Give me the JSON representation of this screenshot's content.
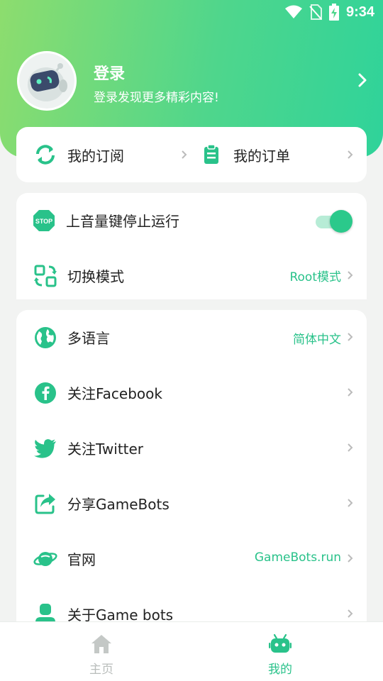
{
  "status": {
    "time": "9:34"
  },
  "profile": {
    "title": "登录",
    "subtitle": "登录发现更多精彩内容!"
  },
  "quick": {
    "subscriptions": "我的订阅",
    "orders": "我的订单"
  },
  "settings": {
    "volume_stop": {
      "label": "上音量键停止运行",
      "stop_text": "STOP",
      "enabled": true
    },
    "switch_mode": {
      "label": "切换模式",
      "value": "Root模式"
    }
  },
  "menu": {
    "language": {
      "label": "多语言",
      "value": "简体中文"
    },
    "facebook": {
      "label": "关注Facebook"
    },
    "twitter": {
      "label": "关注Twitter"
    },
    "share": {
      "label": "分享GameBots"
    },
    "website": {
      "label": "官网",
      "value": "GameBots.run"
    },
    "about": {
      "label": "关于Game bots"
    }
  },
  "tabs": {
    "home": "主页",
    "mine": "我的"
  },
  "colors": {
    "accent": "#29c28a",
    "header_start": "#8ddd6e",
    "header_end": "#2fd39a",
    "inactive": "#b9bdbb"
  }
}
